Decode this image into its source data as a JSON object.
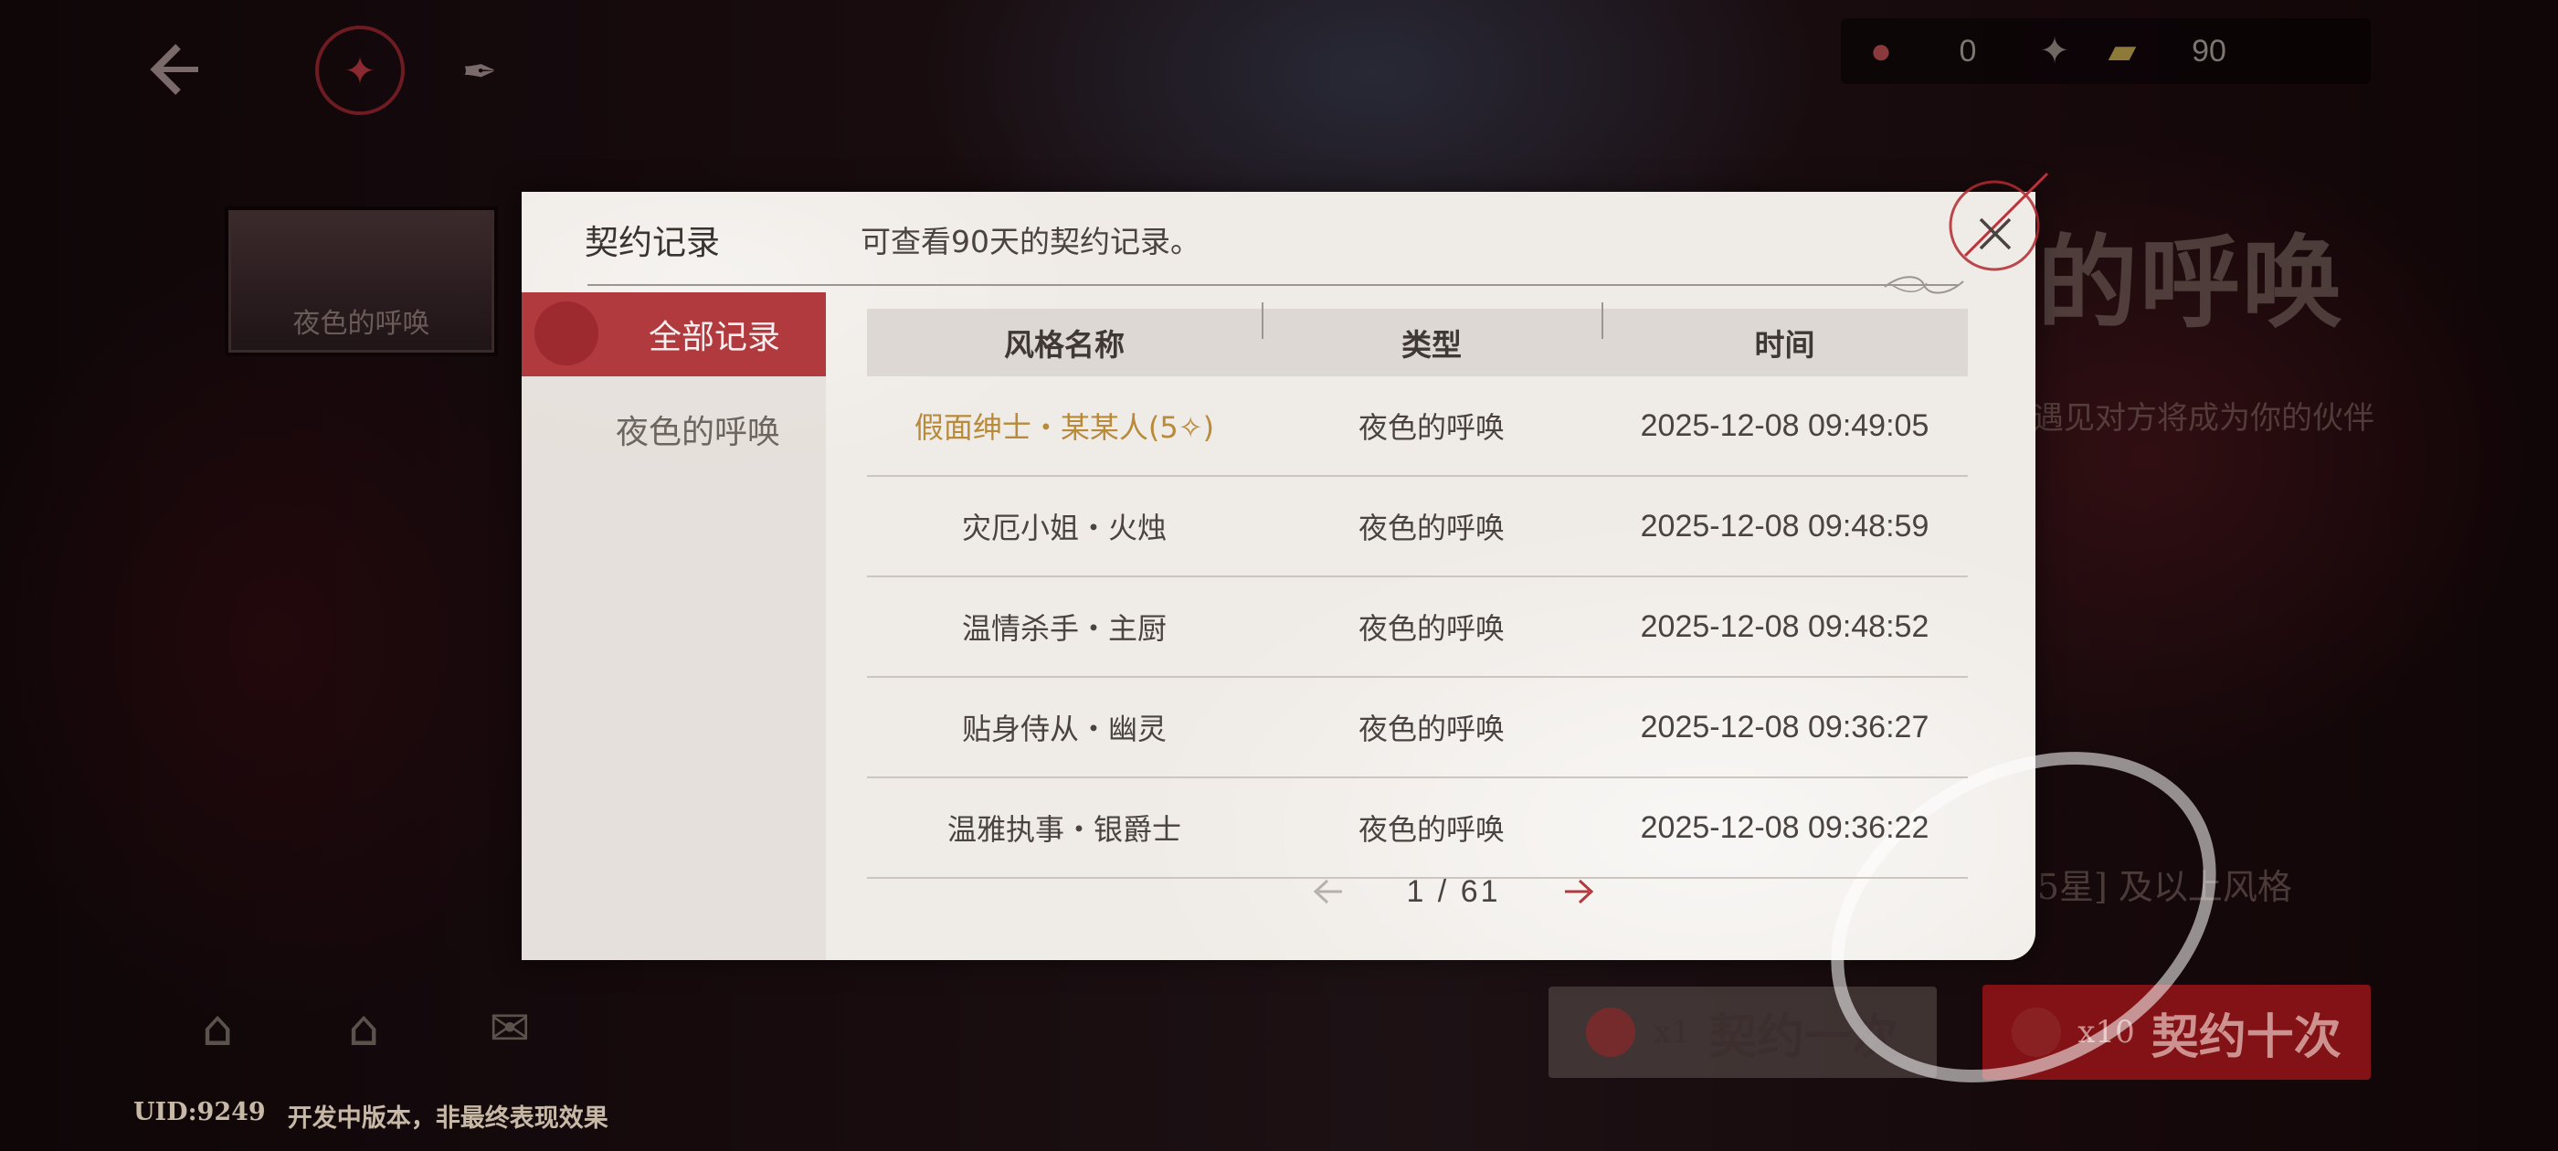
{
  "dialog": {
    "title": "契约记录",
    "note": "可查看90天的契约记录。",
    "tabs": [
      {
        "label": "全部记录",
        "active": true
      },
      {
        "label": "夜色的呼唤",
        "active": false
      }
    ],
    "columns": [
      "风格名称",
      "类型",
      "时间"
    ],
    "rows": [
      {
        "name": "假面绅士・某某人(5✧)",
        "type": "夜色的呼唤",
        "time": "2025-12-08 09:49:05",
        "highlight": true
      },
      {
        "name": "灾厄小姐・火烛",
        "type": "夜色的呼唤",
        "time": "2025-12-08 09:48:59",
        "highlight": false
      },
      {
        "name": "温情杀手・主厨",
        "type": "夜色的呼唤",
        "time": "2025-12-08 09:48:52",
        "highlight": false
      },
      {
        "name": "贴身侍从・幽灵",
        "type": "夜色的呼唤",
        "time": "2025-12-08 09:36:27",
        "highlight": false
      },
      {
        "name": "温雅执事・银爵士",
        "type": "夜色的呼唤",
        "time": "2025-12-08 09:36:22",
        "highlight": false
      }
    ],
    "pagination": {
      "text": "1 / 61",
      "current": 1,
      "total": 61
    }
  },
  "currency": {
    "first_value": "0",
    "second_value": "90"
  },
  "banner": {
    "thumb_label": "夜色的呼唤",
    "title": "的呼唤",
    "subtitle": "遇见对方将成为你的伙伴",
    "rate_text": "[5星] 及以上风格"
  },
  "buttons": {
    "once_count": "x1",
    "once_label": "契约一次",
    "ten_count": "x10",
    "ten_label": "契约十次"
  },
  "footer": {
    "uid": "UID:9249",
    "notice": "开发中版本，非最终表现效果"
  },
  "colors": {
    "accent_red": "#b03a3e",
    "highlight_gold": "#b88a3a",
    "paper": "#efebe6"
  }
}
